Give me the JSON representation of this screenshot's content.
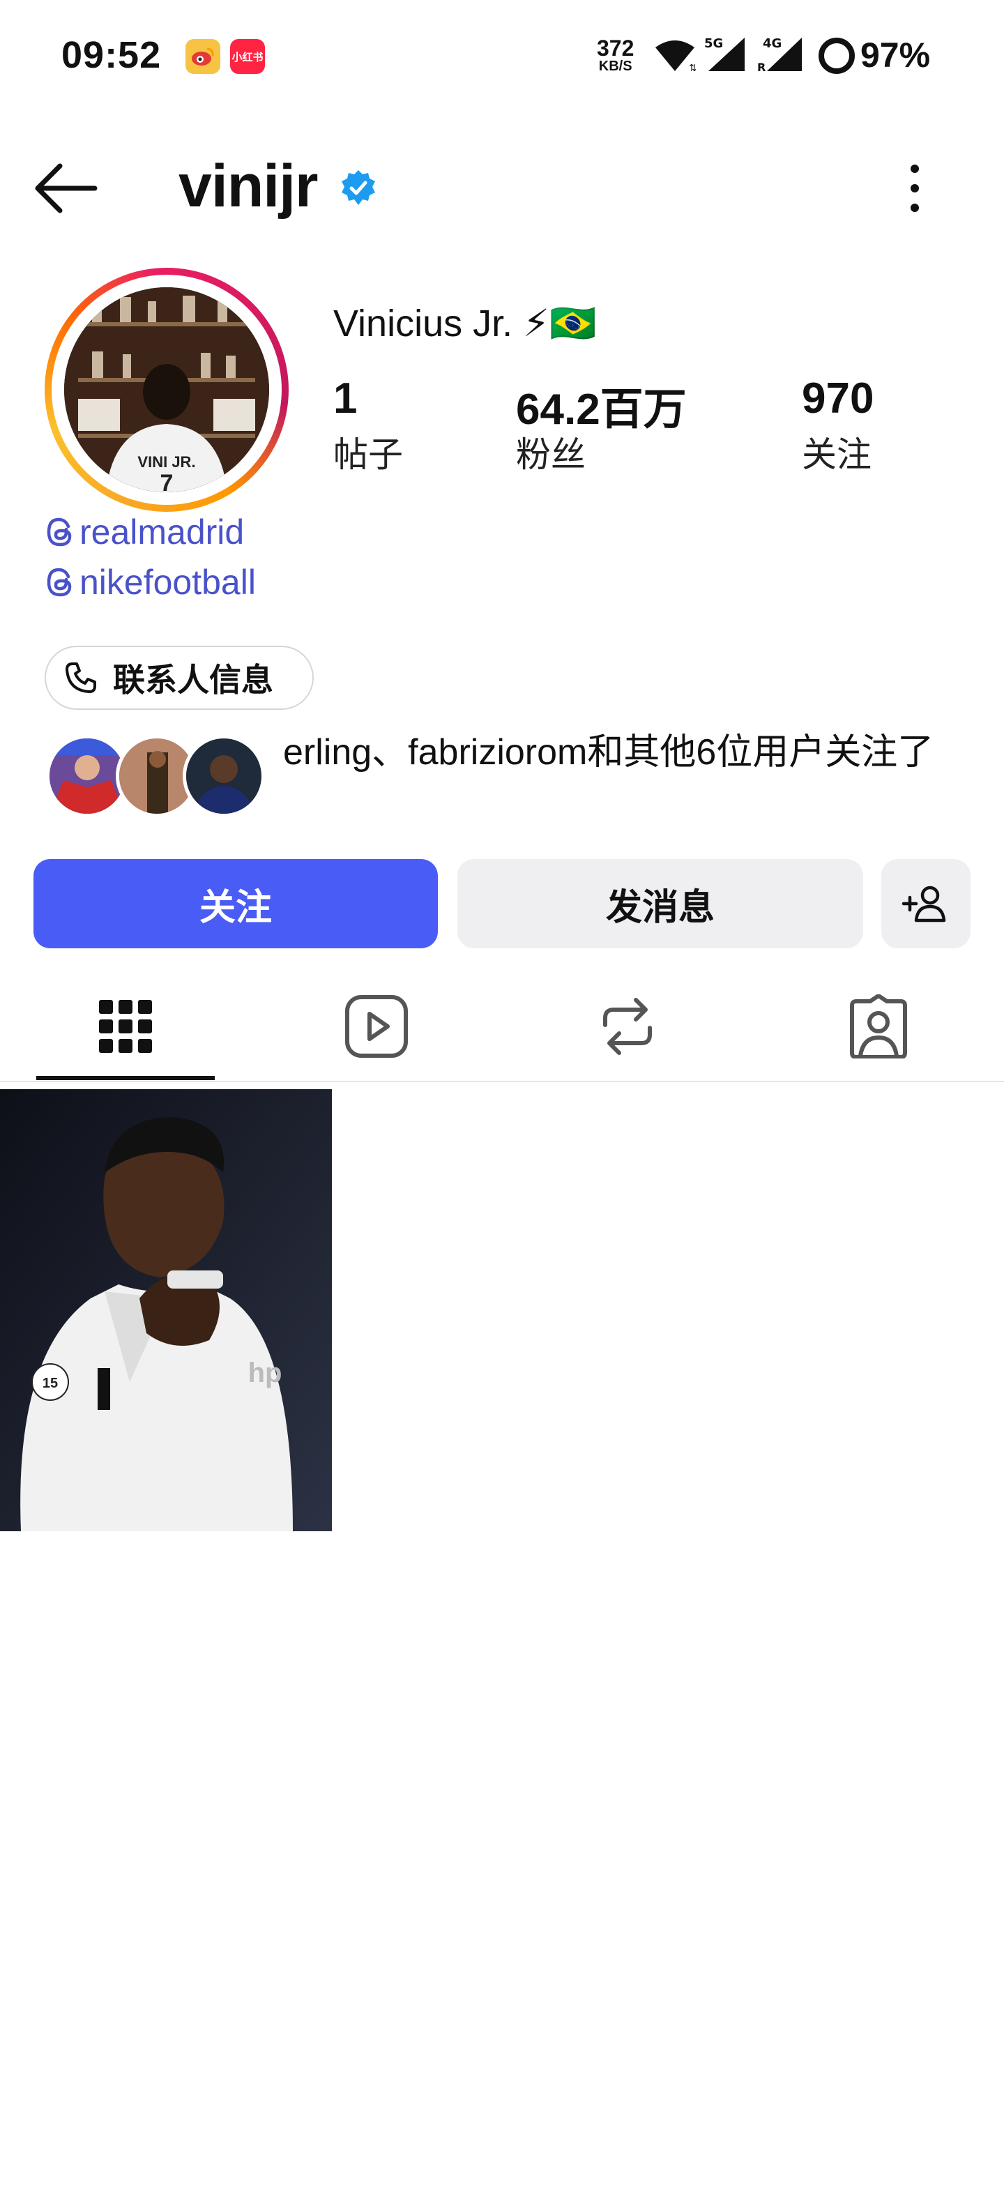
{
  "status_bar": {
    "time": "09:52",
    "app_icons": [
      "weibo-icon",
      "xiaohongshu-icon"
    ],
    "xiaohongshu_label": "小红书",
    "net_speed_value": "372",
    "net_speed_unit": "KB/S",
    "network_5g": "5G",
    "network_4g": "4G",
    "roaming": "R",
    "battery": "97%"
  },
  "header": {
    "username": "vinijr",
    "verified": true,
    "back_icon": "arrow-left-icon",
    "more_icon": "more-vertical-icon"
  },
  "profile": {
    "display_name": "Vinicius Jr. ⚡🇧🇷",
    "stats": [
      {
        "value": "1",
        "label": "帖子"
      },
      {
        "value": "64.2百万",
        "label": "粉丝"
      },
      {
        "value": "970",
        "label": "关注"
      }
    ],
    "links": [
      "realmadrid",
      "nikefootball"
    ],
    "contact_label": "联系人信息",
    "mutual_followers_text": "erling、fabriziorom和其他6位用户关注了"
  },
  "actions": {
    "follow_label": "关注",
    "message_label": "发消息"
  },
  "tabs": [
    "grid-icon",
    "reels-icon",
    "reposts-icon",
    "tagged-icon"
  ],
  "colors": {
    "accent": "#4a5cf6",
    "link": "#4a52c9",
    "verified": "#1d9bf0"
  }
}
